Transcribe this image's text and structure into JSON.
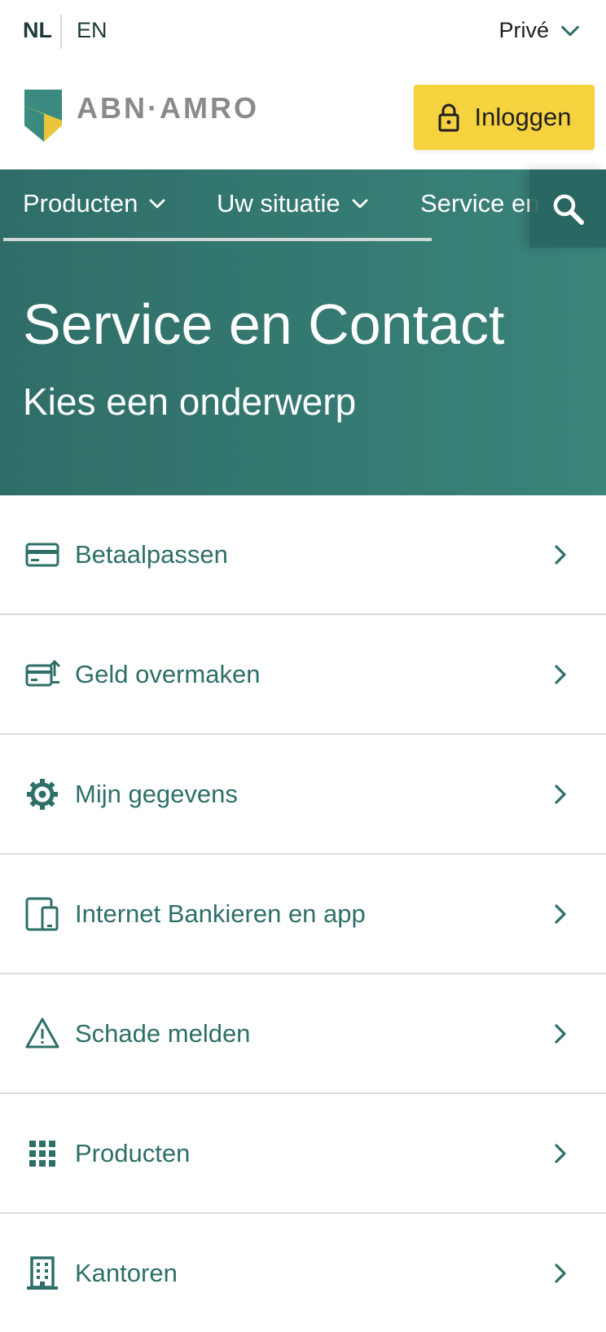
{
  "top": {
    "lang_nl": "NL",
    "lang_en": "EN",
    "segment": "Privé"
  },
  "brand": {
    "name": "ABN·AMRO"
  },
  "login": {
    "label": "Inloggen"
  },
  "nav": {
    "items": [
      "Producten",
      "Uw situatie",
      "Service en"
    ]
  },
  "hero": {
    "title": "Service en Contact",
    "subtitle": "Kies een onderwerp"
  },
  "topics": [
    {
      "label": "Betaalpassen",
      "icon": "card-icon"
    },
    {
      "label": "Geld overmaken",
      "icon": "transfer-icon"
    },
    {
      "label": "Mijn gegevens",
      "icon": "gear-icon"
    },
    {
      "label": "Internet Bankieren en app",
      "icon": "devices-icon"
    },
    {
      "label": "Schade melden",
      "icon": "warning-icon"
    },
    {
      "label": "Producten",
      "icon": "grid-icon"
    },
    {
      "label": "Kantoren",
      "icon": "building-icon"
    }
  ],
  "colors": {
    "accent": "#2e6f68",
    "login_bg": "#f5d23e",
    "hero_bg": "#2f6e68"
  }
}
